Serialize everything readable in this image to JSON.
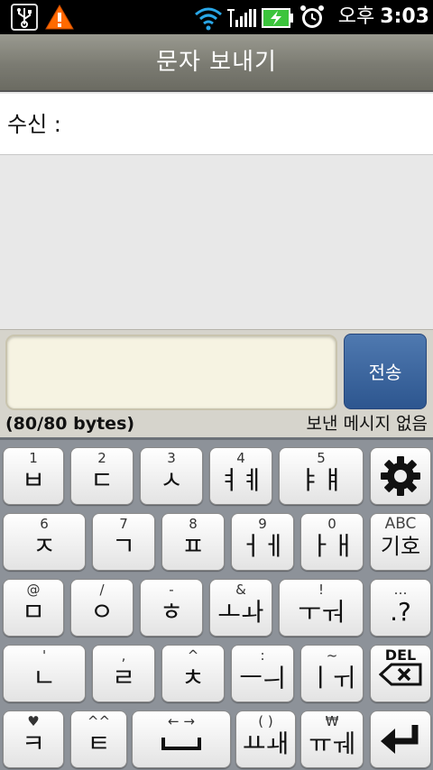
{
  "status_bar": {
    "ampm": "오후",
    "time": "3:03",
    "icons": [
      "usb-icon",
      "warning-icon",
      "wifi-icon",
      "signal-icon",
      "battery-charging-icon",
      "alarm-icon"
    ]
  },
  "title": "문자 보내기",
  "recipient": {
    "label": "수신 :"
  },
  "compose": {
    "send_label": "전송",
    "byte_count": "(80/80 bytes)",
    "status": "보낸 메시지 없음"
  },
  "keyboard": {
    "rows": [
      [
        {
          "top": "1",
          "main": "ㅂ"
        },
        {
          "top": "2",
          "main": "ㄷ"
        },
        {
          "top": "3",
          "main": "ㅅ"
        },
        {
          "top": "4",
          "main": "ㅕㅖ"
        },
        {
          "top": "5",
          "main": "ㅑㅒ"
        },
        {
          "top": "",
          "main": "",
          "icon": "settings-gear-icon"
        }
      ],
      [
        {
          "top": "6",
          "main": "ㅈ"
        },
        {
          "top": "7",
          "main": "ㄱ"
        },
        {
          "top": "8",
          "main": "ㅍ"
        },
        {
          "top": "9",
          "main": "ㅓㅔ"
        },
        {
          "top": "0",
          "main": "ㅏㅐ"
        },
        {
          "top": "ABC",
          "main": "기호"
        }
      ],
      [
        {
          "top": "@",
          "main": "ㅁ"
        },
        {
          "top": "/",
          "main": "ㅇ"
        },
        {
          "top": "-",
          "main": "ㅎ"
        },
        {
          "top": "&",
          "main": "ㅗㅘ"
        },
        {
          "top": "!",
          "main": "ㅜㅝ"
        },
        {
          "top": "…",
          "main": ".?"
        }
      ],
      [
        {
          "top": "'",
          "main": "ㄴ"
        },
        {
          "top": ",",
          "main": "ㄹ"
        },
        {
          "top": "^",
          "main": "ㅊ"
        },
        {
          "top": ":",
          "main": "ㅡㅢ"
        },
        {
          "top": "~",
          "main": "ㅣㅟ"
        },
        {
          "top": "DEL",
          "main": "",
          "icon": "backspace-icon"
        }
      ],
      [
        {
          "top": "♥",
          "main": "ㅋ"
        },
        {
          "top": "^^",
          "main": "ㅌ"
        },
        {
          "top": "← →",
          "main": "␣",
          "icon": "space-icon"
        },
        {
          "top": "( )",
          "main": "ㅛㅙ"
        },
        {
          "top": "₩",
          "main": "ㅠㅞ"
        },
        {
          "top": "",
          "main": "",
          "icon": "enter-icon"
        }
      ]
    ]
  },
  "colors": {
    "title_bar": "#7b7b72",
    "send_button": "#3a6298",
    "keyboard_bg": "#8d9299",
    "compose_bg": "#d6d4cc"
  }
}
